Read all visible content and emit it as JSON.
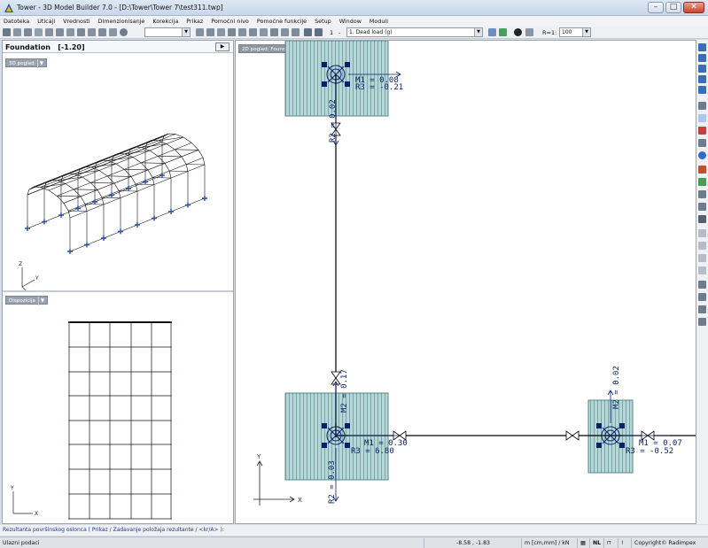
{
  "titlebar": {
    "title": "Tower - 3D Model Builder 7.0 - [D:\\Tower\\Tower 7\\test311.twp]"
  },
  "menu": [
    "Datoteka",
    "Uticaji",
    "Vrednosti",
    "Dimenzionisanje",
    "Korekcija",
    "Prikaz",
    "Pomoćni nivo",
    "Pomoćne funkcije",
    "Setup",
    "Window",
    "Moduli"
  ],
  "toolbar": {
    "layer_combo": "",
    "load_index": "1",
    "load_case": "1. Dead load (g)",
    "ratio_label": "R=1:",
    "ratio_value": "100"
  },
  "left_panel": {
    "title": "Foundation",
    "level": "[-1.20]",
    "view3d_tag": "3D pogled",
    "disposition_tag": "Dispozicija"
  },
  "right_view": {
    "tag": "2D pogled: Foundation  [-1.20]",
    "labels": {
      "top_m1": "M1 = 0.08",
      "top_r3": "R3 = -0.21",
      "top_r2": "R2 = 0.02",
      "bl_m2": "M2 = 0.17",
      "bl_m1": "M1 = 0.30",
      "bl_r3": "R3 = 6.80",
      "bl_r2": "R2 = 0.03",
      "br_m2": "M2 = 0.02",
      "br_m1": "M1 = 0.07",
      "br_r3": "R3 = -0.52"
    },
    "axes": {
      "x": "X",
      "y": "Y"
    }
  },
  "axes3d": {
    "x": "X",
    "y": "Y",
    "z": "Z"
  },
  "status_line": "Rezultanta površinskog oslonca ( Prikaz / Zadavanje položaja rezultante / <kr/A> ):",
  "statusbar": {
    "mode": "Ulazni podaci",
    "coords": "-8.58 , -1.83",
    "units": "m [cm,mm] / kN",
    "nl": "NL",
    "copyright": "Copyright© Radimpex"
  },
  "colors": {
    "accent": "#0a1f6b",
    "footing": "#b8d5d6",
    "footing_stroke": "#5a8a8c",
    "text_blue": "#1b3a8c"
  }
}
